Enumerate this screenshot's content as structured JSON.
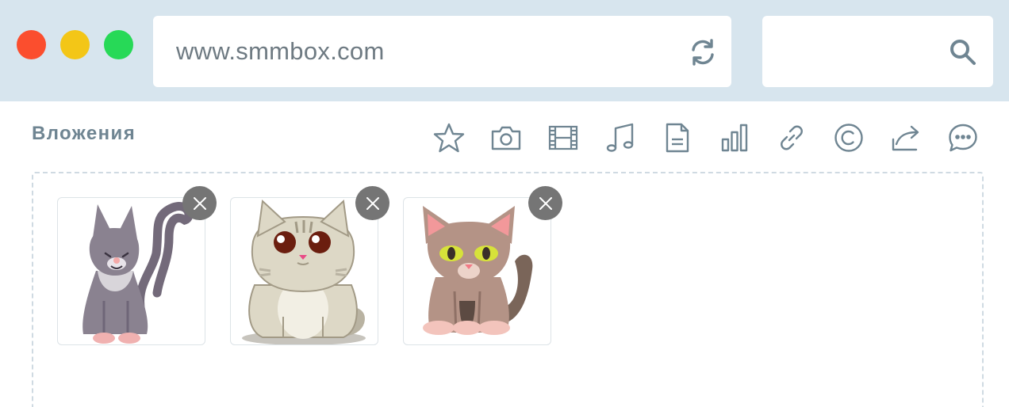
{
  "window": {
    "traffic_lights": [
      {
        "name": "close",
        "color": "#fb4e2e"
      },
      {
        "name": "minimize",
        "color": "#f3c617"
      },
      {
        "name": "maximize",
        "color": "#27d957"
      }
    ]
  },
  "address_bar": {
    "url": "www.smmbox.com",
    "reload_icon": "refresh-icon"
  },
  "search": {
    "value": "",
    "icon": "search-icon"
  },
  "attachments": {
    "label": "Вложения",
    "toolbar": [
      {
        "id": "favorite",
        "icon": "star-icon"
      },
      {
        "id": "photo",
        "icon": "camera-icon"
      },
      {
        "id": "video",
        "icon": "film-icon"
      },
      {
        "id": "audio",
        "icon": "music-note-icon"
      },
      {
        "id": "document",
        "icon": "document-icon"
      },
      {
        "id": "poll",
        "icon": "bar-chart-icon"
      },
      {
        "id": "link",
        "icon": "link-icon"
      },
      {
        "id": "copyright",
        "icon": "copyright-icon"
      },
      {
        "id": "share",
        "icon": "share-icon"
      },
      {
        "id": "comment",
        "icon": "chat-bubble-icon"
      }
    ],
    "images": [
      {
        "subject": "grey cat sitting",
        "remove_icon": "close-icon"
      },
      {
        "subject": "beige fluffy cat with big eyes",
        "remove_icon": "close-icon"
      },
      {
        "subject": "brown kitten with green eyes",
        "remove_icon": "close-icon"
      }
    ]
  },
  "colors": {
    "chrome_bg": "#d7e5ee",
    "icon_stroke": "#6f8592",
    "remove_bg": "#757575"
  }
}
